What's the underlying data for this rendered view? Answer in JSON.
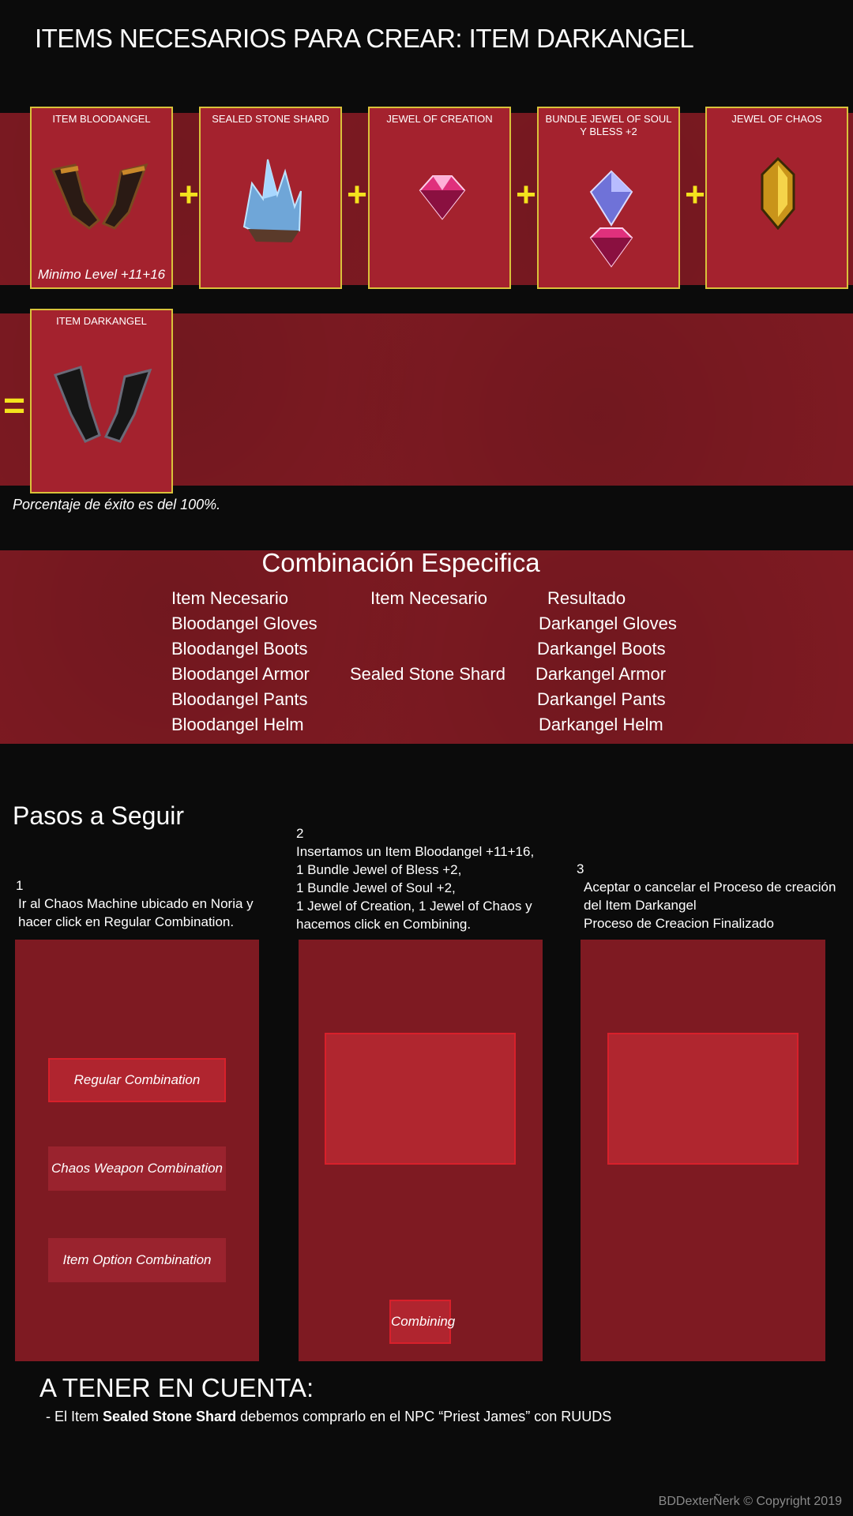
{
  "header": {
    "title": "ITEMS NECESARIOS PARA CREAR: ITEM DARKANGEL"
  },
  "ingredients": [
    {
      "label": "ITEM  BLOODANGEL",
      "note": "Minimo Level +11+16",
      "icon": "bloodangel-gloves-icon"
    },
    {
      "label": "SEALED STONE SHARD",
      "icon": "crystal-shard-icon"
    },
    {
      "label": "JEWEL OF CREATION",
      "icon": "pink-jewel-icon"
    },
    {
      "label": "BUNDLE JEWEL OF SOUL Y BLESS +2",
      "icon": "soul-bless-jewels-icon"
    },
    {
      "label": "JEWEL OF CHAOS",
      "icon": "chaos-jewel-icon"
    }
  ],
  "operators": {
    "plus": "+",
    "equals": "="
  },
  "result": {
    "label": "ITEM  DARKANGEL",
    "icon": "darkangel-gloves-icon"
  },
  "success_rate": "Porcentaje de éxito es del 100%.",
  "combination": {
    "title": "Combinación Especifica",
    "headers": [
      "Item Necesario",
      "Item Necesario",
      "Resultado"
    ],
    "col1": [
      "Bloodangel Gloves",
      "Bloodangel Boots",
      "Bloodangel Armor",
      "Bloodangel Pants",
      "Bloodangel Helm"
    ],
    "col2": "Sealed Stone Shard",
    "col3": [
      "Darkangel Gloves",
      "Darkangel Boots",
      "Darkangel Armor",
      "Darkangel Pants",
      "Darkangel Helm"
    ]
  },
  "steps": {
    "title": "Pasos a Seguir",
    "step1": {
      "num": "1",
      "text": "Ir al Chaos Machine ubicado en Noria y hacer click en Regular Combination."
    },
    "step2": {
      "num": "2",
      "lines": [
        "Insertamos un Item  Bloodangel +11+16,",
        "1 Bundle Jewel of Bless +2,",
        "1 Bundle Jewel of Soul +2,",
        "1 Jewel of Creation, 1 Jewel of Chaos y",
        "hacemos click en Combining."
      ]
    },
    "step3": {
      "num": "3",
      "lines": [
        "Aceptar o cancelar el Proceso de creación",
        "del Item Darkangel",
        "Proceso de Creacion Finalizado"
      ]
    }
  },
  "chaos_buttons": [
    "Regular Combination",
    "Chaos Weapon Combination",
    "Item Option Combination"
  ],
  "combining_button": "Combining",
  "tener": {
    "title": "A TENER EN CUENTA:",
    "prefix": "- El Item ",
    "bold": "Sealed Stone Shard",
    "suffix": " debemos comprarlo en el NPC “Priest James” con RUUDS"
  },
  "copyright": "BDDexterÑerk © Copyright 2019",
  "colors": {
    "band": "#7e1a22",
    "card": "#a4222e",
    "card_border": "#d9c23a",
    "plus": "#f4e31d",
    "slot_border": "#d8202b"
  }
}
